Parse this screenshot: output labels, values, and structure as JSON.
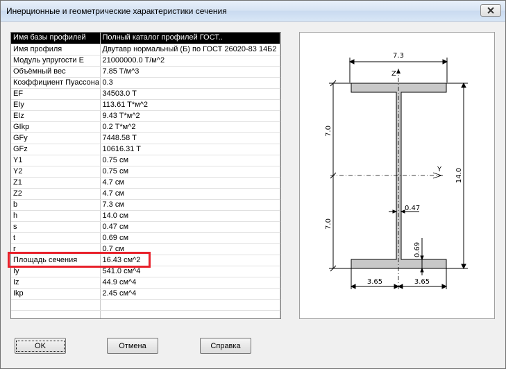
{
  "window": {
    "title": "Инерционные и геометрические характеристики сечения"
  },
  "properties": [
    [
      "Имя базы профилей",
      "Полный каталог профилей ГОСТ.."
    ],
    [
      "Имя профиля",
      "Двутавр нормальный (Б) по ГОСТ 26020-83 14Б2"
    ],
    [
      "Модуль упругости E",
      "21000000.0 T/м^2"
    ],
    [
      "Объёмный вес",
      "7.85 T/м^3"
    ],
    [
      "Коэффициент Пуассона",
      "0.3"
    ],
    [
      "EF",
      "34503.0 T"
    ],
    [
      "EIy",
      "113.61 T*м^2"
    ],
    [
      "EIz",
      "9.43 T*м^2"
    ],
    [
      "GIkp",
      "0.2 T*м^2"
    ],
    [
      "GFy",
      "7448.58 T"
    ],
    [
      "GFz",
      "10616.31 T"
    ],
    [
      "Y1",
      "0.75 см"
    ],
    [
      "Y2",
      "0.75 см"
    ],
    [
      "Z1",
      "4.7 см"
    ],
    [
      "Z2",
      "4.7 см"
    ],
    [
      "b",
      "7.3 см"
    ],
    [
      "h",
      "14.0 см"
    ],
    [
      "s",
      "0.47 см"
    ],
    [
      "t",
      "0.69 см"
    ],
    [
      "r",
      "0.7 см"
    ],
    [
      "Площадь сечения",
      "16.43 см^2"
    ],
    [
      "Iy",
      "541.0 см^4"
    ],
    [
      "Iz",
      "44.9 см^4"
    ],
    [
      "Ikp",
      "2.45 см^4"
    ],
    [
      "",
      ""
    ],
    [
      "",
      ""
    ]
  ],
  "drawing": {
    "width_label": "7.3",
    "height_label": "14.0",
    "half_height_top": "7.0",
    "half_height_bottom": "7.0",
    "web_label": "0.47",
    "flange_label": "0.69",
    "half_width_left": "3.65",
    "half_width_right": "3.65",
    "axis_z": "Z",
    "axis_y": "Y",
    "fill_color": "#c8c8c8"
  },
  "buttons": {
    "ok": "OK",
    "cancel": "Отмена",
    "help": "Справка"
  },
  "close_icon": "close-icon"
}
